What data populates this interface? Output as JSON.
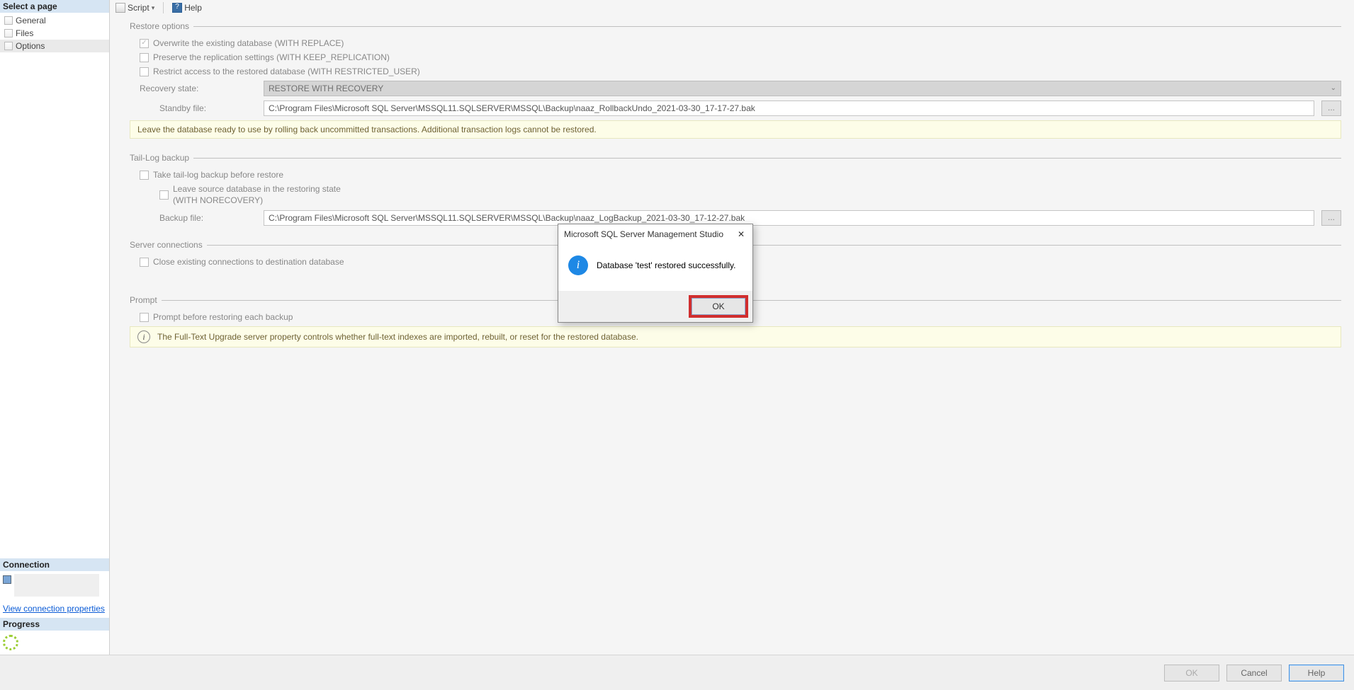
{
  "sidebar": {
    "header": "Select a page",
    "items": [
      {
        "label": "General"
      },
      {
        "label": "Files"
      },
      {
        "label": "Options"
      }
    ],
    "connection_header": "Connection",
    "view_conn_link": "View connection properties",
    "progress_header": "Progress"
  },
  "toolbar": {
    "script_label": "Script",
    "help_label": "Help"
  },
  "restore_options": {
    "title": "Restore options",
    "overwrite": "Overwrite the existing database (WITH REPLACE)",
    "preserve": "Preserve the replication settings (WITH KEEP_REPLICATION)",
    "restrict": "Restrict access to the restored database (WITH RESTRICTED_USER)",
    "recovery_state_label": "Recovery state:",
    "recovery_state_value": "RESTORE WITH RECOVERY",
    "standby_label": "Standby file:",
    "standby_value": "C:\\Program Files\\Microsoft SQL Server\\MSSQL11.SQLSERVER\\MSSQL\\Backup\\naaz_RollbackUndo_2021-03-30_17-17-27.bak",
    "info_text": "Leave the database ready to use by rolling back uncommitted transactions. Additional transaction logs cannot be restored."
  },
  "tail_log": {
    "title": "Tail-Log backup",
    "take_tail": "Take tail-log backup before restore",
    "leave_source": "Leave source database in the restoring state\n(WITH NORECOVERY)",
    "backup_file_label": "Backup file:",
    "backup_file_value": "C:\\Program Files\\Microsoft SQL Server\\MSSQL11.SQLSERVER\\MSSQL\\Backup\\naaz_LogBackup_2021-03-30_17-12-27.bak"
  },
  "server_conn": {
    "title": "Server connections",
    "close_existing": "Close existing connections to destination database"
  },
  "prompt": {
    "title": "Prompt",
    "prompt_before": "Prompt before restoring each backup",
    "fulltext_info": "The Full-Text Upgrade server property controls whether full-text indexes are imported, rebuilt, or reset for the restored database."
  },
  "buttons": {
    "ok": "OK",
    "cancel": "Cancel",
    "help": "Help",
    "browse": "..."
  },
  "dialog": {
    "title": "Microsoft SQL Server Management Studio",
    "message": "Database 'test' restored successfully.",
    "ok": "OK"
  }
}
